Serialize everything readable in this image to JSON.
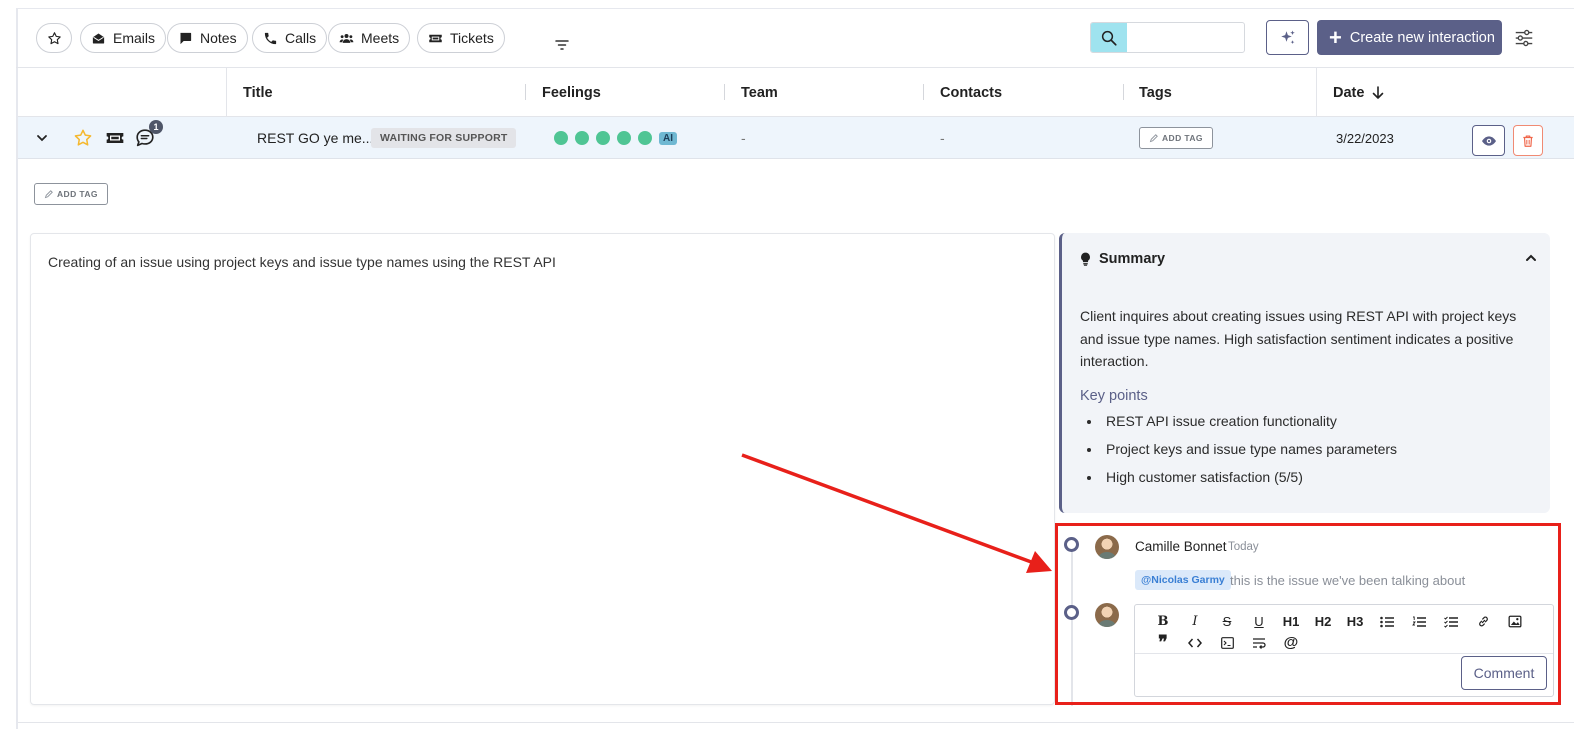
{
  "toolbar": {
    "chips": [
      {
        "label": "Emails",
        "icon": "envelope-icon"
      },
      {
        "label": "Notes",
        "icon": "note-icon"
      },
      {
        "label": "Calls",
        "icon": "phone-icon"
      },
      {
        "label": "Meets",
        "icon": "people-icon"
      },
      {
        "label": "Tickets",
        "icon": "ticket-icon"
      }
    ],
    "search_placeholder": "",
    "create_label": "Create new interaction"
  },
  "columns": {
    "title": "Title",
    "feelings": "Feelings",
    "team": "Team",
    "contacts": "Contacts",
    "tags": "Tags",
    "date": "Date"
  },
  "row": {
    "notification_count": "1",
    "title": "REST GO ye me...",
    "status": "WAITING FOR SUPPORT",
    "feelings_score": 5,
    "ai_badge": "AI",
    "team": "-",
    "contacts": "-",
    "add_tag": "ADD TAG",
    "date": "3/22/2023"
  },
  "detail": {
    "add_tag": "ADD TAG",
    "description": "Creating of an issue using project keys and issue type names using the REST API",
    "summary": {
      "title": "Summary",
      "body": "Client inquires about creating issues using REST API with project keys and issue type names. High satisfaction sentiment indicates a positive interaction.",
      "key_points_title": "Key points",
      "key_points": [
        "REST API issue creation functionality",
        "Project keys and issue type names parameters",
        "High customer satisfaction (5/5)"
      ]
    }
  },
  "comments": {
    "author": "Camille Bonnet",
    "time": "Today",
    "mention": "@Nicolas Garmy",
    "text": "this is the issue we've been talking about",
    "editor_tools": [
      "B",
      "I",
      "S",
      "U",
      "H1",
      "H2",
      "H3",
      "bullet-list",
      "ordered-list",
      "task-list",
      "link",
      "image",
      "quote",
      "code",
      "code-block",
      "wrap",
      "@"
    ],
    "comment_button": "Comment"
  },
  "colors": {
    "accent": "#5b6088",
    "feeling_dot": "#4fc594",
    "annotation_red": "#e8201a",
    "search_button": "#9fe3ef",
    "star": "#f5b82e"
  }
}
